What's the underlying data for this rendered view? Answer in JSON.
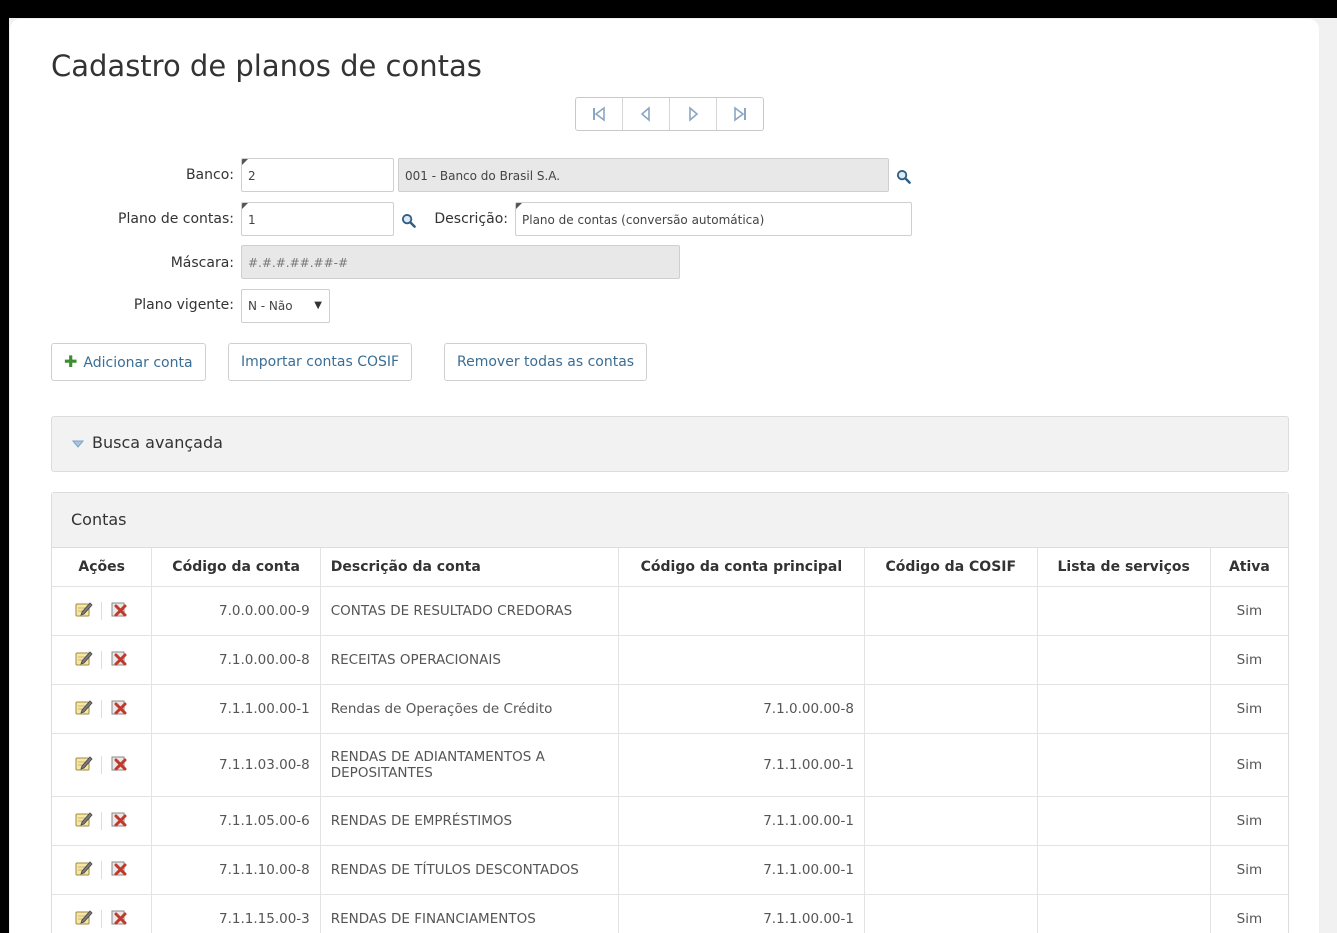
{
  "page_title": "Cadastro de planos de contas",
  "pager": {
    "icons": [
      "first-page-icon",
      "previous-page-icon",
      "next-page-icon",
      "last-page-icon"
    ]
  },
  "form": {
    "banco_label": "Banco:",
    "banco_value": "2",
    "banco_name": "001 - Banco do Brasil S.A.",
    "plano_label": "Plano de contas:",
    "plano_value": "1",
    "descricao_label": "Descrição:",
    "descricao_value": "Plano de contas (conversão automática)",
    "mascara_label": "Máscara:",
    "mascara_value": "#.#.#.##.##-#",
    "vigente_label": "Plano vigente:",
    "vigente_value": "N - Não"
  },
  "actions": {
    "add_label": "Adicionar conta",
    "import_label": "Importar contas COSIF",
    "remove_label": "Remover todas as contas"
  },
  "busca": {
    "title": "Busca avançada"
  },
  "contas": {
    "title": "Contas",
    "columns": [
      "Ações",
      "Código da conta",
      "Descrição da conta",
      "Código da conta principal",
      "Código da COSIF",
      "Lista de serviços",
      "Ativa"
    ],
    "rows": [
      {
        "codigo": "7.0.0.00.00-9",
        "descricao": "CONTAS DE RESULTADO CREDORAS",
        "principal": "",
        "cosif": "",
        "servicos": "",
        "ativa": "Sim"
      },
      {
        "codigo": "7.1.0.00.00-8",
        "descricao": "RECEITAS OPERACIONAIS",
        "principal": "",
        "cosif": "",
        "servicos": "",
        "ativa": "Sim"
      },
      {
        "codigo": "7.1.1.00.00-1",
        "descricao": "Rendas de Operações de Crédito",
        "principal": "7.1.0.00.00-8",
        "cosif": "",
        "servicos": "",
        "ativa": "Sim"
      },
      {
        "codigo": "7.1.1.03.00-8",
        "descricao": "RENDAS DE ADIANTAMENTOS A DEPOSITANTES",
        "principal": "7.1.1.00.00-1",
        "cosif": "",
        "servicos": "",
        "ativa": "Sim"
      },
      {
        "codigo": "7.1.1.05.00-6",
        "descricao": "RENDAS DE EMPRÉSTIMOS",
        "principal": "7.1.1.00.00-1",
        "cosif": "",
        "servicos": "",
        "ativa": "Sim"
      },
      {
        "codigo": "7.1.1.10.00-8",
        "descricao": "RENDAS DE TÍTULOS DESCONTADOS",
        "principal": "7.1.1.00.00-1",
        "cosif": "",
        "servicos": "",
        "ativa": "Sim"
      },
      {
        "codigo": "7.1.1.15.00-3",
        "descricao": "RENDAS DE FINANCIAMENTOS",
        "principal": "7.1.1.00.00-1",
        "cosif": "",
        "servicos": "",
        "ativa": "Sim"
      }
    ]
  },
  "colors": {
    "link": "#3a6e95",
    "plus": "#3c8d2f",
    "delete": "#c0392b"
  }
}
